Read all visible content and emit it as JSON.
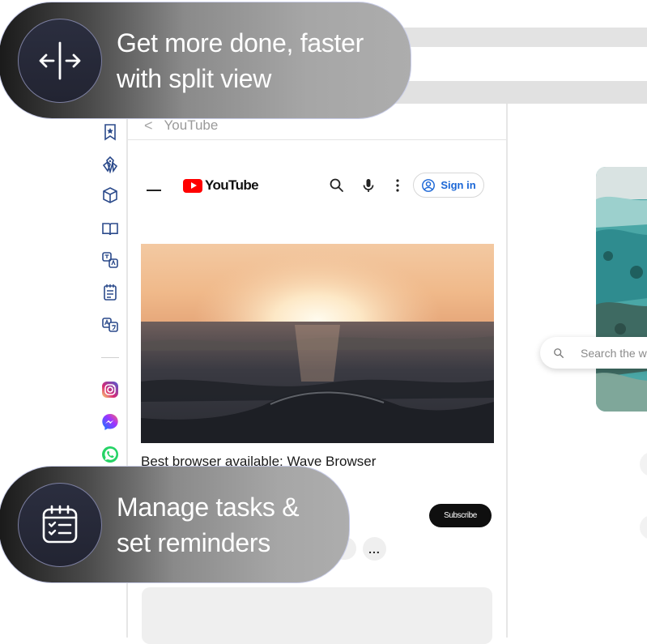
{
  "navigation": {
    "back_label": "<",
    "pane_title": "YouTube"
  },
  "youtube": {
    "logo_text": "YouTube",
    "sign_in_label": "Sign in",
    "video_title": "Best browser available: Wave Browser",
    "subscribe_label": "Subscribe",
    "more_label": "..."
  },
  "right_pane": {
    "search_placeholder": "Search the w"
  },
  "features": [
    {
      "line1": "Get more done, faster",
      "line2": "with split view",
      "icon": "split-view-icon"
    },
    {
      "line1": "Manage tasks &",
      "line2": "set reminders",
      "icon": "task-list-icon"
    }
  ],
  "sidebar": {
    "items": [
      "bookmark-icon",
      "shopping-tag-icon",
      "package-icon",
      "reading-book-icon",
      "translate-icon",
      "notes-icon",
      "language-icon",
      "instagram-icon",
      "messenger-icon",
      "whatsapp-icon"
    ]
  },
  "colors": {
    "youtube_red": "#FF0000",
    "sign_in_blue": "#1A66D6",
    "sidebar_icon": "#2B4A8B",
    "instagram": "#E1306C",
    "messenger": "#7A5CFF",
    "whatsapp": "#25D366"
  }
}
